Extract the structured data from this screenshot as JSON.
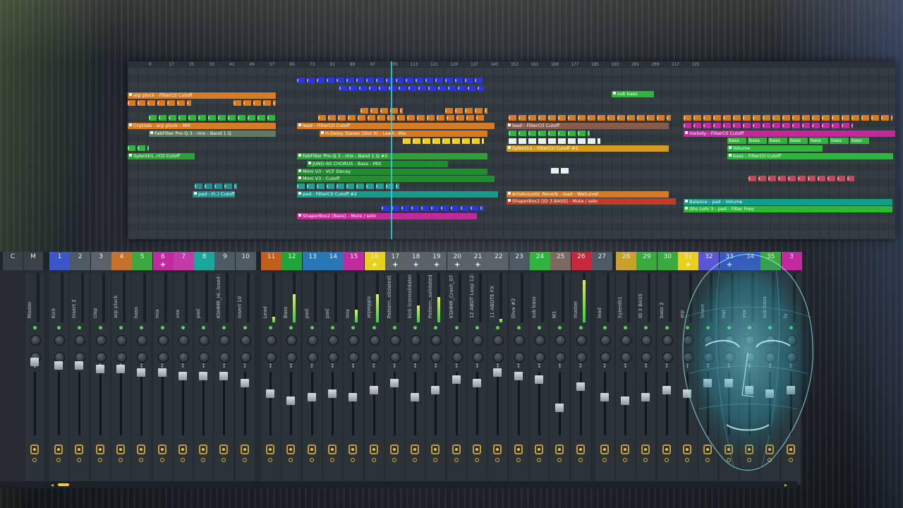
{
  "playlist": {
    "ruler": [
      "9",
      "17",
      "25",
      "33",
      "41",
      "49",
      "57",
      "65",
      "73",
      "81",
      "89",
      "97",
      "105",
      "113",
      "121",
      "129",
      "137",
      "145",
      "153",
      "161",
      "169",
      "177",
      "185",
      "193",
      "201",
      "209",
      "217",
      "225"
    ],
    "clips": [
      {
        "label": "arp pluck - FilterCtl Cutoff",
        "color": "#d77a21"
      },
      {
        "label": "Crystals - arp pluck - MIX",
        "color": "#d77a21"
      },
      {
        "label": "FabFilter Pro-Q 3 - mix - Band 1 Q",
        "color": "#5f7a5f"
      },
      {
        "label": "Sylenth1..rCtl Cutoff",
        "color": "#2f9f3c"
      },
      {
        "label": "pad - Fi..l Cutoff",
        "color": "#1f8f8f"
      },
      {
        "label": "lead - FilterCtl Cutoff",
        "color": "#d77a21"
      },
      {
        "label": "H-Delay Stereo (Slot 9) - Lead - Mix",
        "color": "#d77a21"
      },
      {
        "label": "FabFilter Pro-Q 3 - mix - Band 1 Q #2",
        "color": "#2f9f3c"
      },
      {
        "label": "JUNO-60 CHORUS - Bass - MIX",
        "color": "#1d8f2c"
      },
      {
        "label": "Mimi V3 - VCF Decay",
        "color": "#1d8f2c"
      },
      {
        "label": "Mimi V3 - Cutoff",
        "color": "#1d8f2c"
      },
      {
        "label": "pad - FilterCtl Cutoff #2",
        "color": "#169a8a"
      },
      {
        "label": "ShaperBox2 [Bass] - Mute / solo",
        "color": "#c22a9c"
      },
      {
        "label": "lead - FilterCtl Cutoff",
        "color": "#8a5a4a"
      },
      {
        "label": "Sylenth1 - FilterCtl Cutoff #2",
        "color": "#d69a1f"
      },
      {
        "label": "ArtsAcoustic Reverb - lead - WetLevel",
        "color": "#d77a21"
      },
      {
        "label": "ShaperBox2 [ID 3 BASS] - Mute / solo",
        "color": "#c23a2a"
      },
      {
        "label": "melody - FilterCtl Cutoff",
        "color": "#c22a9c"
      },
      {
        "label": "Volume",
        "color": "#2fb43c"
      },
      {
        "label": "bass - FilterCtl Cutoff",
        "color": "#2fb43c"
      },
      {
        "label": "Balance - pad - Volume",
        "color": "#169a8a"
      },
      {
        "label": "Ghz Lohi 3 - pad - Filter Freq",
        "color": "#2fb43c"
      },
      {
        "label": "sub bass",
        "color": "#2fb43c"
      }
    ],
    "patterns": [
      "bass",
      "bass",
      "bass",
      "bass",
      "bass",
      "bass",
      "bass"
    ]
  },
  "mixer": {
    "header_labels": [
      "C",
      "M",
      "1",
      "2",
      "3",
      "4",
      "5",
      "6",
      "7",
      "8",
      "9",
      "10",
      "11",
      "12",
      "13",
      "14",
      "15",
      "16",
      "17",
      "18",
      "19",
      "20",
      "21",
      "22",
      "23",
      "24",
      "25",
      "26",
      "27",
      "28",
      "29",
      "30",
      "31",
      "32",
      "33",
      "34",
      "35",
      "3"
    ],
    "header_colors": [
      "#3a4248",
      "#3a4248",
      "#3b56c8",
      "#4d5a63",
      "#5a6268",
      "#c8712a",
      "#3aa93f",
      "#c32aa0",
      "#c43ba8",
      "#18a79a",
      "#4d5a63",
      "#4d5a63",
      "#c25e1a",
      "#1ea63c",
      "#2a77b8",
      "#2a77b8",
      "#c32aa0",
      "#e9cf1e",
      "#5a6268",
      "#5a6268",
      "#5a6268",
      "#5a6268",
      "#5a6268",
      "#5a6268",
      "#4d5a63",
      "#2fb43c",
      "#7a6a62",
      "#c8283a",
      "#4d5a63",
      "#c8a02a",
      "#3aa93f",
      "#3aa93f",
      "#e9cf1e",
      "#5b56d8",
      "#3b56c8",
      "#3b56c8",
      "#3aa93f",
      "#c32aa0"
    ],
    "strips": [
      {
        "label": "Master"
      },
      {
        "label": "Kick"
      },
      {
        "label": "Insert 2"
      },
      {
        "label": "clap"
      },
      {
        "label": "arp pluck"
      },
      {
        "label": "bass"
      },
      {
        "label": "mix"
      },
      {
        "label": "vox"
      },
      {
        "label": "pad"
      },
      {
        "label": "KSHMR_Hi..losed 06"
      },
      {
        "label": "Insert 10"
      },
      {
        "label": "Lead"
      },
      {
        "label": "Bass"
      },
      {
        "label": "pad"
      },
      {
        "label": "pad"
      },
      {
        "label": "mix"
      },
      {
        "label": "arpeggio"
      },
      {
        "label": "Pattern..olidated)"
      },
      {
        "label": "kick (consolidated)"
      },
      {
        "label": "Pattern..solidated"
      },
      {
        "label": "KSHMR_Crash_07"
      },
      {
        "label": "12 ABDT Loop 124"
      },
      {
        "label": "11 ABDTE FX"
      },
      {
        "label": "Diva #2"
      },
      {
        "label": "sub bass"
      },
      {
        "label": "M1"
      },
      {
        "label": "master"
      },
      {
        "label": "lead"
      },
      {
        "label": "Sylenth1"
      },
      {
        "label": "ID 3 BASS"
      },
      {
        "label": "bass 2"
      },
      {
        "label": "arp"
      },
      {
        "label": "Snare"
      },
      {
        "label": "Hat"
      },
      {
        "label": "vox"
      },
      {
        "label": "sub bass"
      },
      {
        "label": "fx"
      }
    ]
  },
  "icons": {
    "automation": "automation-dot-icon",
    "face_art": "glowing-face-wireframe-icon",
    "scroll_left": "arrow-left-icon",
    "scroll_right": "arrow-right-icon"
  }
}
